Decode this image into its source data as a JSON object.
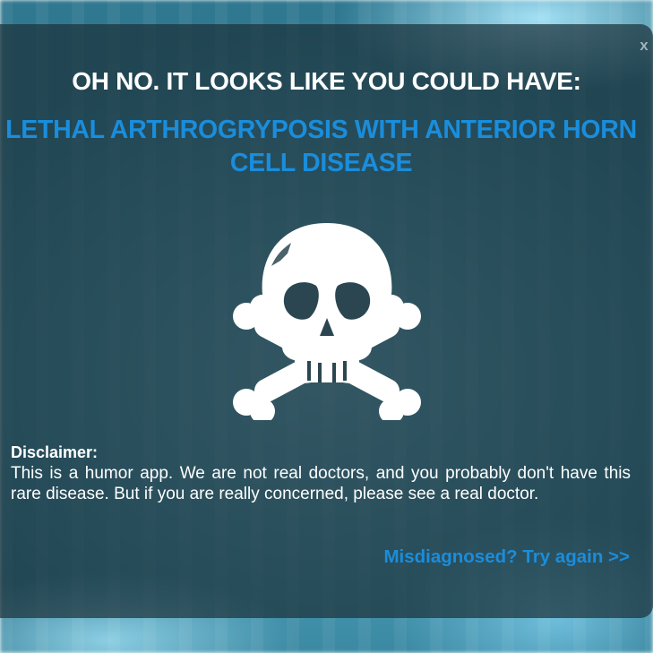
{
  "modal": {
    "close_label": "x",
    "headline": "OH NO. IT LOOKS LIKE YOU COULD HAVE:",
    "disease_name": "LETHAL ARTHROGRYPOSIS WITH ANTERIOR HORN CELL DISEASE",
    "illustration_icon": "skull-and-crossbones-icon",
    "disclaimer_title": "Disclaimer:",
    "disclaimer_text": "This is a humor app. We are not real doctors, and you probably don't have this rare disease. But if you are really concerned, please see a real doctor.",
    "retry_label": "Misdiagnosed? Try again >>"
  },
  "colors": {
    "accent": "#1a8ddc",
    "headline": "#ffffff",
    "overlay": "#1c323a"
  }
}
